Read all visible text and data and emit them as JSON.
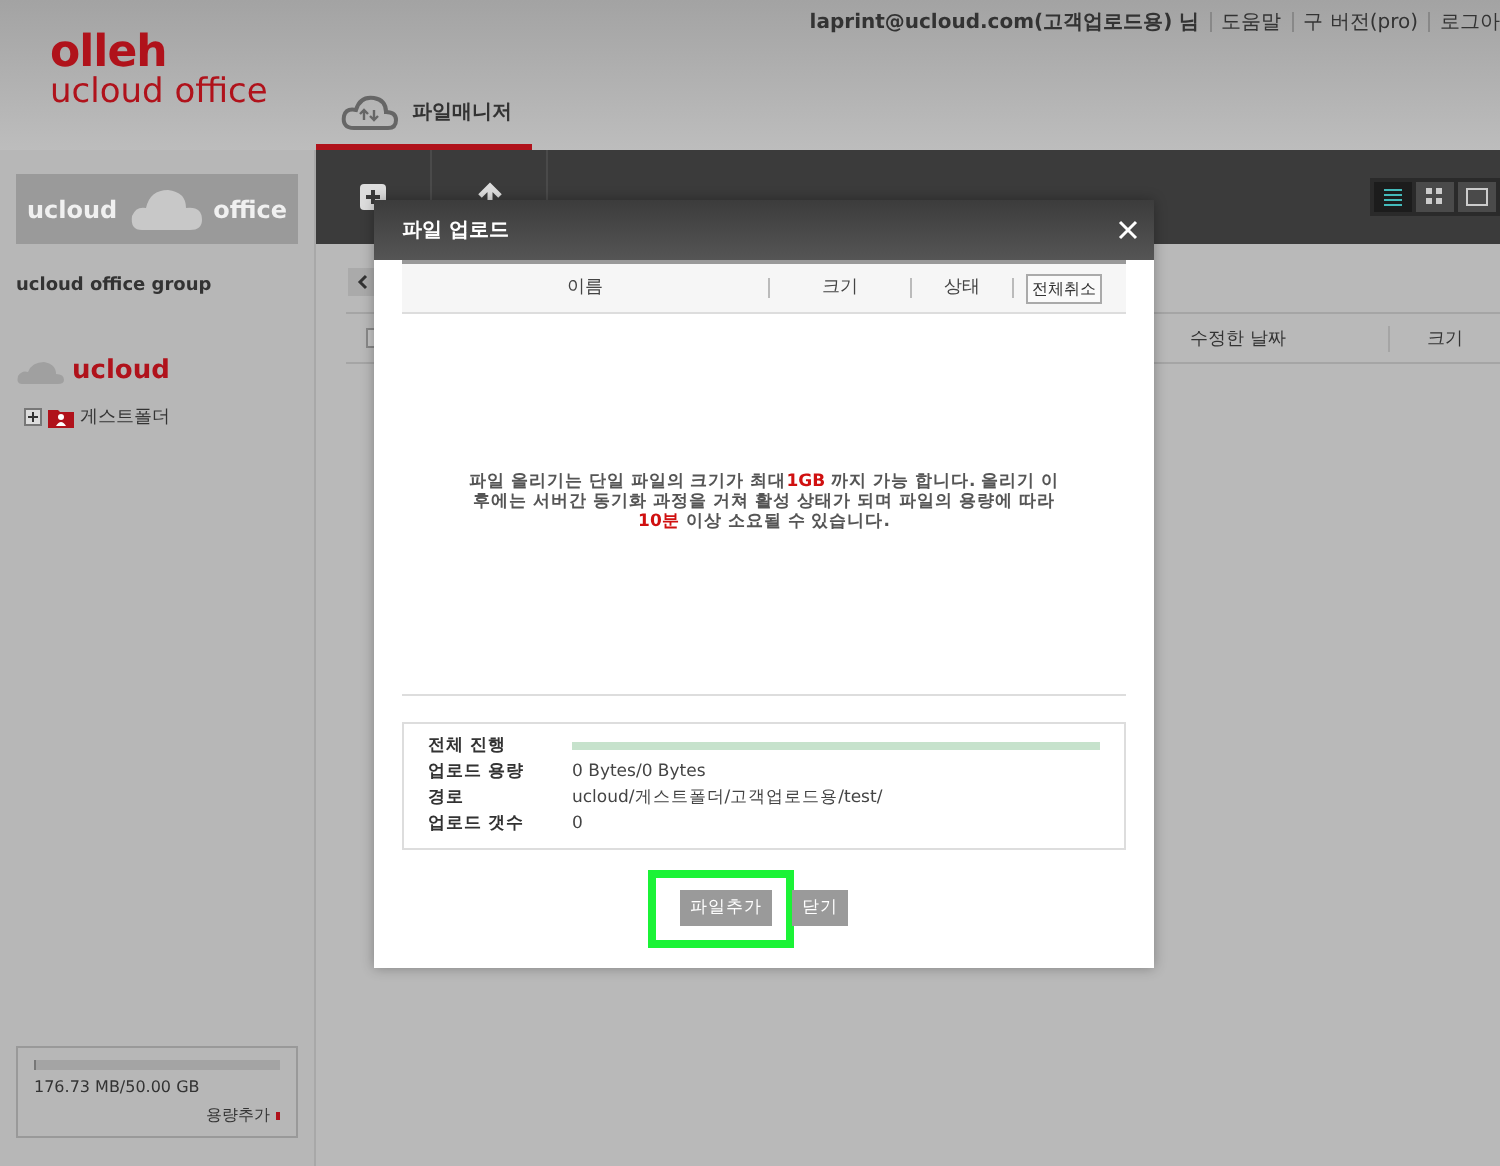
{
  "header": {
    "logo_top": "olleh",
    "logo_bottom": "ucloud office",
    "user": "laprint@ucloud.com(고객업로드용) 님",
    "links": [
      "도움말",
      "구 버전(pro)",
      "로그아"
    ],
    "tabs": [
      {
        "label": "파일매니저",
        "selected": true
      }
    ]
  },
  "sidebar": {
    "logo_left": "ucloud",
    "logo_right": "office",
    "group": "ucloud office group",
    "section": "ucloud",
    "tree": [
      {
        "label": "게스트폴더",
        "expanded": false
      }
    ],
    "storage": {
      "level": 0.004,
      "reading": "176.73 MB/50.00 GB",
      "link": "용량추가"
    }
  },
  "toolbar": {
    "buttons": [
      {
        "kind": "new"
      },
      {
        "kind": "upload"
      }
    ],
    "views": [
      {
        "kind": "list",
        "selected": true
      },
      {
        "kind": "grid",
        "selected": false
      },
      {
        "kind": "preview",
        "selected": false
      }
    ]
  },
  "main": {
    "checked": false,
    "columns": [
      "수정한 날짜",
      "크기"
    ]
  },
  "dialog": {
    "title": "파일 업로드",
    "columns": [
      "이름",
      "크기",
      "상태"
    ],
    "cancel_all": "전체취소",
    "message": "파일 올리기는 단일 파일의 크기가 최대**1GB** 까지 가능 합니다. 올리기 이후에는 서버간 동기화 과정을 거쳐 활성 상태가 되며 파일의 용량에 따라**10분** 이상 소요될 수 있습니다.",
    "progress": {
      "label": "전체 진행",
      "level": 1
    },
    "info": [
      {
        "label": "업로드 용량",
        "value": "0 Bytes/0 Bytes"
      },
      {
        "label": "경로",
        "value": "ucloud/게스트폴더/고객업로드용/test/"
      },
      {
        "label": "업로드 갯수",
        "value": "0"
      }
    ],
    "buttons": [
      {
        "label": "파일추가",
        "highlighted": true
      },
      {
        "label": "닫기",
        "highlighted": false
      }
    ]
  }
}
